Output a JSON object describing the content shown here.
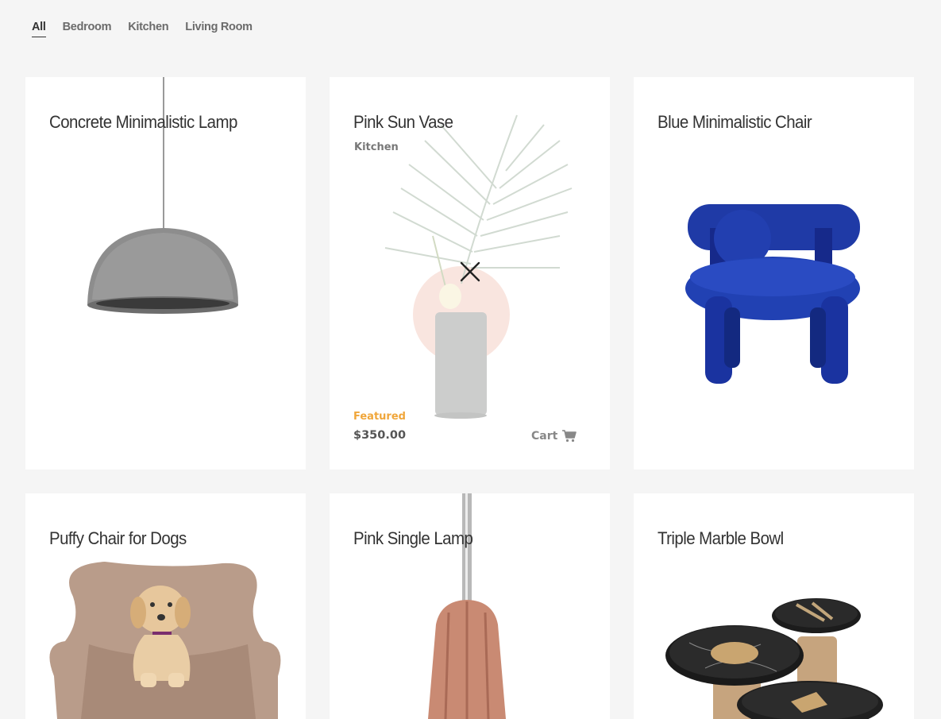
{
  "filters": [
    {
      "label": "All",
      "active": true
    },
    {
      "label": "Bedroom",
      "active": false
    },
    {
      "label": "Kitchen",
      "active": false
    },
    {
      "label": "Living Room",
      "active": false
    }
  ],
  "products": [
    {
      "title": "Concrete Minimalistic Lamp",
      "image": "concrete-lamp"
    },
    {
      "title": "Pink Sun Vase",
      "image": "pink-vase",
      "category": "Kitchen",
      "badge": "Featured",
      "price": "$350.00",
      "cart_label": "Cart"
    },
    {
      "title": "Blue Minimalistic Chair",
      "image": "blue-chair"
    },
    {
      "title": "Puffy Chair for Dogs",
      "image": "dog-chair"
    },
    {
      "title": "Pink Single Lamp",
      "image": "pink-lamp"
    },
    {
      "title": "Triple Marble Bowl",
      "image": "marble-bowls"
    }
  ],
  "colors": {
    "background": "#f5f5f5",
    "card": "#ffffff",
    "featured": "#f0a63a",
    "text": "#333333"
  }
}
